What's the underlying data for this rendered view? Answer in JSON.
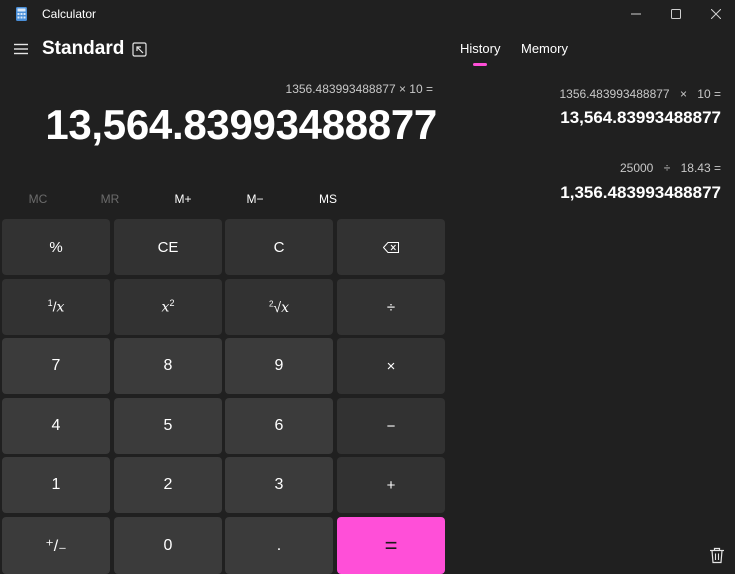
{
  "window": {
    "title": "Calculator",
    "colors": {
      "background": "#202020",
      "key": "#3b3b3b",
      "accent": "#ff4fd8"
    }
  },
  "header": {
    "mode": "Standard"
  },
  "display": {
    "expression": "1356.483993488877 × 10 =",
    "result": "13,564.83993488877"
  },
  "memory": {
    "buttons": [
      "MC",
      "MR",
      "M+",
      "M−",
      "MS"
    ]
  },
  "keys": {
    "percent": "%",
    "clear_entry": "CE",
    "clear": "C",
    "divide": "÷",
    "multiply": "×",
    "subtract": "−",
    "add": "+",
    "equals": "=",
    "seven": "7",
    "eight": "8",
    "nine": "9",
    "four": "4",
    "five": "5",
    "six": "6",
    "one": "1",
    "two": "2",
    "three": "3",
    "zero": "0",
    "decimal": ".",
    "negate": "⁺/₋"
  },
  "panel": {
    "tabs": [
      "History",
      "Memory"
    ],
    "active_tab": "History",
    "history": [
      {
        "operand1": "1356.483993488877",
        "operator": "×",
        "operand2": "10 =",
        "result": "13,564.83993488877"
      },
      {
        "operand1": "25000",
        "operator": "÷",
        "operand2": "18.43 =",
        "result": "1,356.483993488877"
      }
    ]
  }
}
